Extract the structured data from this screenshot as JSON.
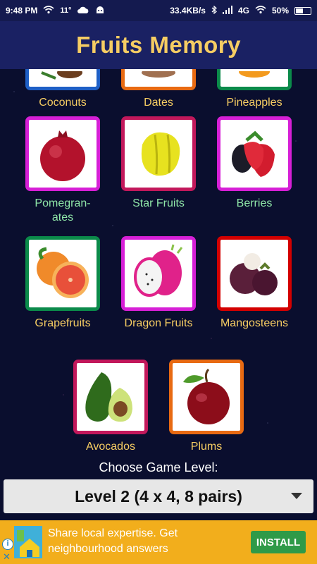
{
  "status_bar": {
    "time": "9:48 PM",
    "temperature": "11°",
    "network_speed": "33.4KB/s",
    "signal": "4G",
    "battery": "50%"
  },
  "app": {
    "title": "Fruits Memory"
  },
  "fruits": [
    {
      "label": "Coconuts",
      "border": "#1e5fc6",
      "label_color": "yellow"
    },
    {
      "label": "Dates",
      "border": "#e86a12",
      "label_color": "yellow"
    },
    {
      "label": "Pineapples",
      "border": "#0b8a4a",
      "label_color": "yellow"
    },
    {
      "label": "Pomegran-\nates",
      "border": "#d61fd6",
      "label_color": "green"
    },
    {
      "label": "Star Fruits",
      "border": "#c2185b",
      "label_color": "green"
    },
    {
      "label": "Berries",
      "border": "#d61fd6",
      "label_color": "green"
    },
    {
      "label": "Grapefruits",
      "border": "#0b8a4a",
      "label_color": "yellow"
    },
    {
      "label": "Dragon Fruits",
      "border": "#d61fd6",
      "label_color": "yellow"
    },
    {
      "label": "Mangosteens",
      "border": "#d30000",
      "label_color": "yellow"
    },
    {
      "label": "Avocados",
      "border": "#c2185b",
      "label_color": "yellow"
    },
    {
      "label": "Plums",
      "border": "#e86a12",
      "label_color": "yellow"
    }
  ],
  "level_picker": {
    "prompt": "Choose Game Level:",
    "selected": "Level 2 (4 x 4, 8 pairs)"
  },
  "ad": {
    "text": "Share local expertise. Get neighbourhood answers",
    "install_label": "INSTALL"
  },
  "colors": {
    "background": "#0a0e2e",
    "header": "#1a2163",
    "title": "#f6cd63",
    "ad_background": "#f2ae1c",
    "install_button": "#2f9a48"
  }
}
